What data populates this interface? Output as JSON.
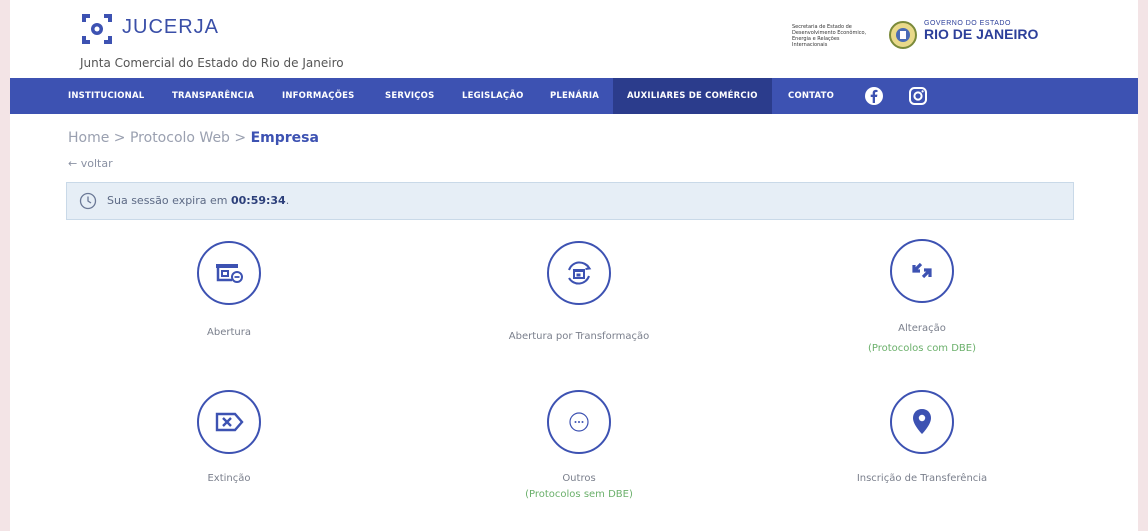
{
  "header": {
    "logo_text": "JUCERJA",
    "logo_subtitle": "Junta Comercial do Estado do Rio de Janeiro",
    "gov_small_text": "Secretaria de Estado de Desenvolvimento Econômico, Energia e Relações Internacionais",
    "gov_line1": "GOVERNO DO ESTADO",
    "gov_line2": "RIO DE JANEIRO"
  },
  "nav": {
    "items": [
      {
        "label": "INSTITUCIONAL"
      },
      {
        "label": "TRANSPARÊNCIA"
      },
      {
        "label": "INFORMAÇÕES"
      },
      {
        "label": "SERVIÇOS"
      },
      {
        "label": "LEGISLAÇÃO"
      },
      {
        "label": "PLENÁRIA"
      },
      {
        "label": "AUXILIARES DE COMÉRCIO"
      },
      {
        "label": "CONTATO"
      }
    ],
    "social": [
      "facebook-icon",
      "instagram-icon"
    ],
    "colors": {
      "bar": "#3d52b2",
      "active": "#2b3c8c"
    }
  },
  "breadcrumb": {
    "home": "Home",
    "sep": " > ",
    "middle": "Protocolo Web",
    "current": "Empresa"
  },
  "back": "← voltar",
  "session": {
    "prefix": "Sua sessão expira em ",
    "time": "00:59:34",
    "suffix": "."
  },
  "options": [
    {
      "label": "Abertura",
      "icon": "storefront-icon"
    },
    {
      "label": "Abertura por Transformação",
      "icon": "transform-icon"
    },
    {
      "label": "Alteração",
      "note": "(Protocolos com DBE)",
      "icon": "swap-arrows-icon"
    },
    {
      "label": "Extinção",
      "icon": "close-tag-icon"
    },
    {
      "label": "Outros",
      "note": "(Protocolos sem DBE)",
      "icon": "more-icon"
    },
    {
      "label": "Inscrição de Transferência",
      "icon": "location-pin-icon"
    }
  ],
  "accent": "#3d52b2",
  "note_color": "#6bb06b"
}
